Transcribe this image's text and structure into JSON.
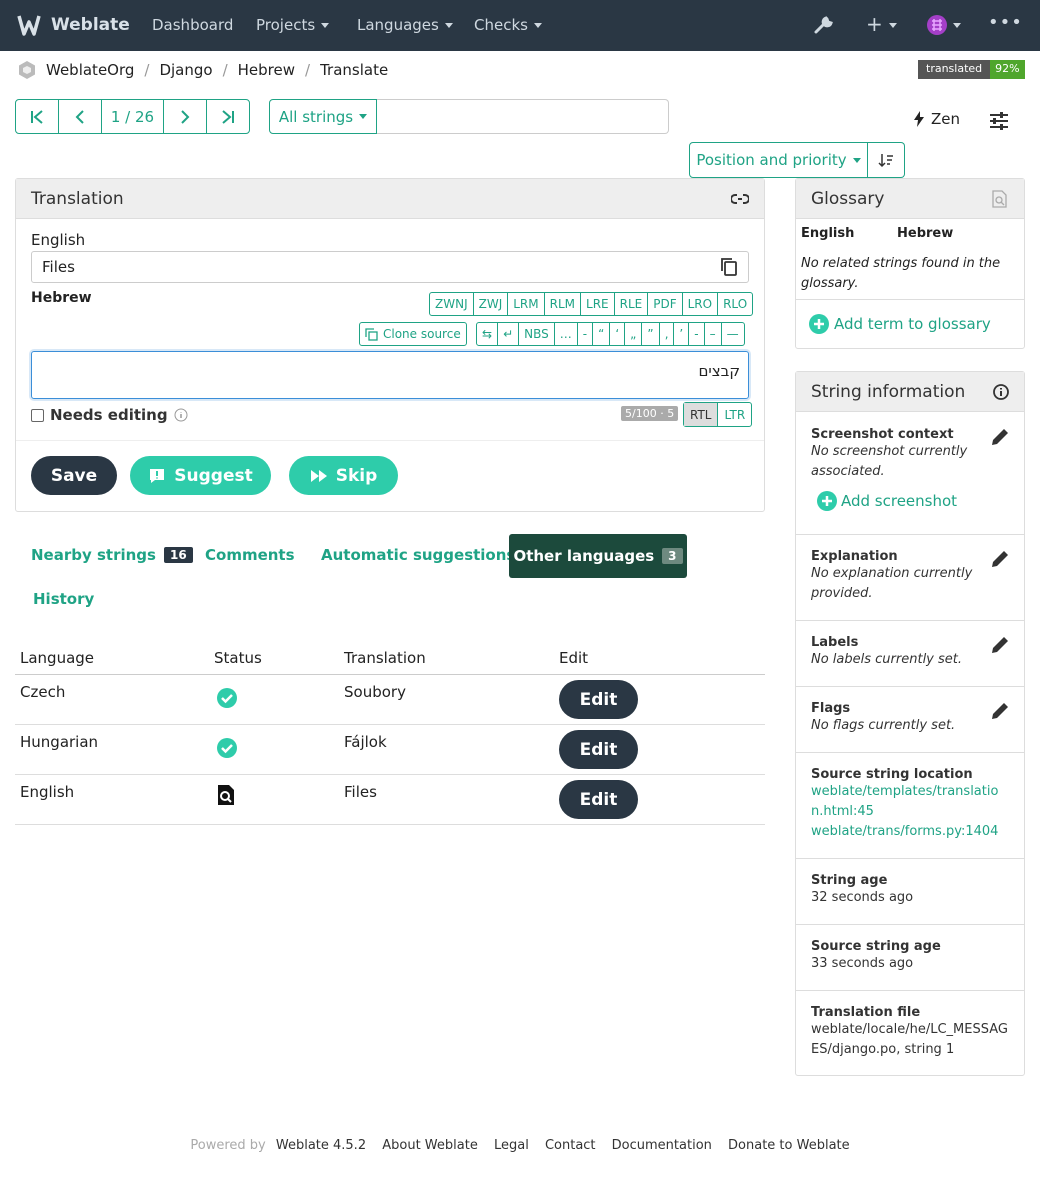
{
  "nav": {
    "brand": "Weblate",
    "items": [
      "Dashboard",
      "Projects",
      "Languages",
      "Checks"
    ]
  },
  "breadcrumb": [
    "WeblateOrg",
    "Django",
    "Hebrew",
    "Translate"
  ],
  "progress": {
    "label": "translated",
    "value": "92%"
  },
  "pager": {
    "position": "1 / 26"
  },
  "search": {
    "filter": "All strings",
    "placeholder": ""
  },
  "zen": "Zen",
  "sort": "Position and priority",
  "translation": {
    "title": "Translation",
    "source_lang": "English",
    "source_text": "Files",
    "target_lang": "Hebrew",
    "dir_marks": [
      "ZWNJ",
      "ZWJ",
      "LRM",
      "RLM",
      "LRE",
      "RLE",
      "PDF",
      "LRO",
      "RLO"
    ],
    "clone_source": "Clone source",
    "special_chars": [
      "⇆",
      "↵",
      "NBS",
      "…",
      "‑",
      "“",
      "‘",
      "„",
      "”",
      "‚",
      "’",
      "-",
      "–",
      "—"
    ],
    "target_text": "קבצים",
    "needs_editing": "Needs editing",
    "counter": "5/100 · 5",
    "rtl": "RTL",
    "ltr": "LTR",
    "save": "Save",
    "suggest": "Suggest",
    "skip": "Skip"
  },
  "tabs": {
    "nearby": "Nearby strings",
    "nearby_count": "16",
    "comments": "Comments",
    "suggestions": "Automatic suggestions",
    "other": "Other languages",
    "other_count": "3",
    "history": "History"
  },
  "table": {
    "headers": [
      "Language",
      "Status",
      "Translation",
      "Edit"
    ],
    "rows": [
      {
        "language": "Czech",
        "status": "approved",
        "translation": "Soubory",
        "edit": "Edit"
      },
      {
        "language": "Hungarian",
        "status": "approved",
        "translation": "Fájlok",
        "edit": "Edit"
      },
      {
        "language": "English",
        "status": "source",
        "translation": "Files",
        "edit": "Edit"
      }
    ]
  },
  "glossary": {
    "title": "Glossary",
    "col_source": "English",
    "col_target": "Hebrew",
    "empty": "No related strings found in the glossary.",
    "add": "Add term to glossary"
  },
  "info": {
    "title": "String information",
    "screenshot_h": "Screenshot context",
    "screenshot_t": "No screenshot currently associated.",
    "add_screenshot": "Add screenshot",
    "explanation_h": "Explanation",
    "explanation_t": "No explanation currently provided.",
    "labels_h": "Labels",
    "labels_t": "No labels currently set.",
    "flags_h": "Flags",
    "flags_t": "No flags currently set.",
    "location_h": "Source string location",
    "location_1": "weblate/templates/translation.html:45",
    "location_2": "weblate/trans/forms.py:1404",
    "age_h": "String age",
    "age_t": "32 seconds ago",
    "src_age_h": "Source string age",
    "src_age_t": "33 seconds ago",
    "file_h": "Translation file",
    "file_t": "weblate/locale/he/LC_MESSAGES/django.po, string 1"
  },
  "footer": {
    "powered": "Powered by",
    "version": "Weblate 4.5.2",
    "links": [
      "About Weblate",
      "Legal",
      "Contact",
      "Documentation",
      "Donate to Weblate"
    ]
  },
  "colors": {
    "navbar": "#2a3744",
    "accent": "#1fa385",
    "approved": "#2eccaa"
  }
}
